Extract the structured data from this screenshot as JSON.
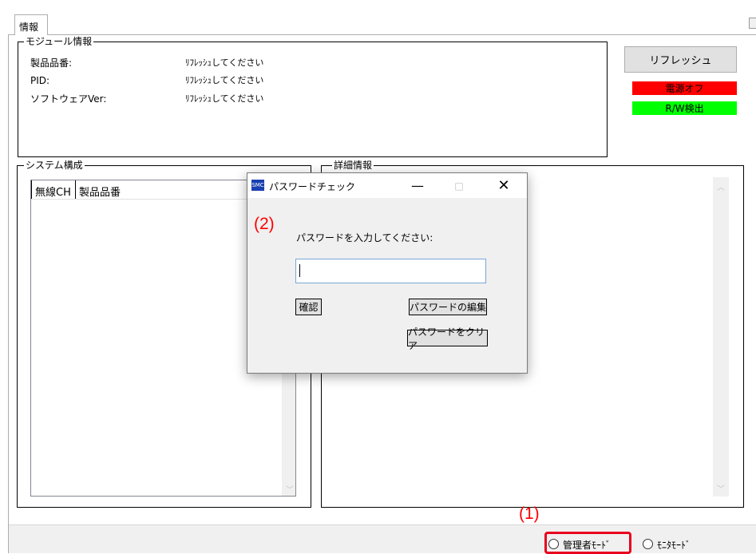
{
  "tab": {
    "label": "情報"
  },
  "module_info": {
    "title": "モジュール情報",
    "rows": [
      {
        "label": "製品品番:",
        "value": "ﾘﾌﾚｯｼｭしてください"
      },
      {
        "label": "PID:",
        "value": "ﾘﾌﾚｯｼｭしてください"
      },
      {
        "label": "ソフトウェアVer:",
        "value": "ﾘﾌﾚｯｼｭしてください"
      }
    ]
  },
  "refresh_button": "リフレッシュ",
  "status": {
    "power": "電源オフ",
    "power_color": "#ff0000",
    "rw": "R/W検出",
    "rw_color": "#00ff00"
  },
  "system_config": {
    "title": "システム構成",
    "columns": [
      "無線CH",
      "製品品番"
    ]
  },
  "detail": {
    "title": "詳細情報"
  },
  "dialog": {
    "title": "パスワードチェック",
    "icon_text": "SMC",
    "prompt": "パスワードを入力してください:",
    "password_value": "",
    "confirm_button": "確認",
    "edit_button": "パスワードの編集",
    "clear_button": "パスワードをクリア",
    "minimize": "—",
    "maximize": "□",
    "close": "✕"
  },
  "annotations": {
    "step1": "(1)",
    "step2": "(2)",
    "color": "#ff0000"
  },
  "modes": {
    "admin": "管理者ﾓｰﾄﾞ",
    "monitor": "ﾓﾆﾀﾓｰﾄﾞ"
  }
}
